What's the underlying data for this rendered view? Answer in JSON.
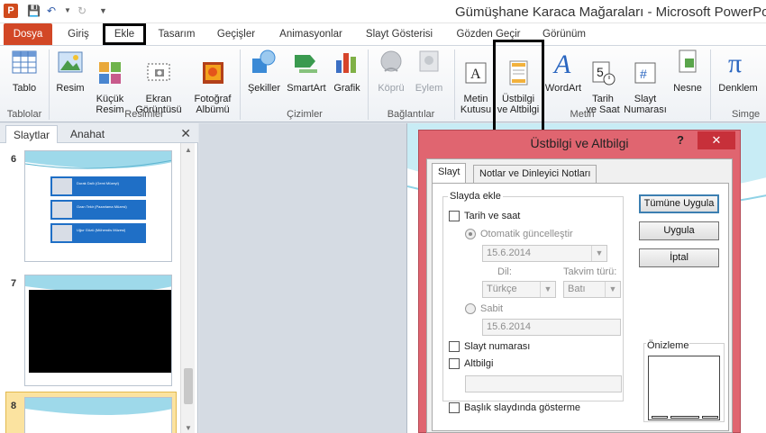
{
  "window": {
    "title": "Gümüşhane Karaca Mağaraları - Microsoft PowerPoint",
    "app_icon_letter": "P"
  },
  "tabs": [
    {
      "label": "Dosya"
    },
    {
      "label": "Giriş"
    },
    {
      "label": "Ekle"
    },
    {
      "label": "Tasarım"
    },
    {
      "label": "Geçişler"
    },
    {
      "label": "Animasyonlar"
    },
    {
      "label": "Slayt Gösterisi"
    },
    {
      "label": "Gözden Geçir"
    },
    {
      "label": "Görünüm"
    }
  ],
  "ribbon": {
    "buttons": {
      "tablo": "Tablo",
      "resim": "Resim",
      "kucuk_resim": "Küçük\nResim",
      "ekran_goruntusu": "Ekran\nGörüntüsü",
      "fotograf_albumu": "Fotoğraf\nAlbümü",
      "sekiller": "Şekiller",
      "smartart": "SmartArt",
      "grafik": "Grafik",
      "kopru": "Köprü",
      "eylem": "Eylem",
      "metin_kutusu": "Metin\nKutusu",
      "ustbilgi": "Üstbilgi\nve Altbilgi",
      "wordart": "WordArt",
      "tarih_saat": "Tarih\nve Saat",
      "slayt_numarasi": "Slayt\nNumarası",
      "nesne": "Nesne",
      "denklem": "Denklem"
    },
    "groups": {
      "tablolar": "Tablolar",
      "resimler": "Resimler",
      "cizimler": "Çizimler",
      "baglantilar": "Bağlantılar",
      "metin": "Metin",
      "simgeler": "Simge"
    }
  },
  "leftpane": {
    "tab_slides": "Slaytlar",
    "tab_outline": "Anahat",
    "slides": [
      {
        "number": "6",
        "items": [
          "Durak Dallı (Gemi Müzeyi)",
          "Ozan Tekir (Pazarlama Müzesi)",
          "Uğur Gözü (Mühendis Müzesi)"
        ]
      },
      {
        "number": "7"
      },
      {
        "number": "8"
      }
    ]
  },
  "dialog": {
    "title": "Üstbilgi ve Altbilgi",
    "help": "?",
    "close": "✕",
    "tabs": [
      "Slayt",
      "Notlar ve Dinleyici Notları"
    ],
    "section_label": "Slayda ekle",
    "date_time_label": "Tarih ve saat",
    "auto_update_label": "Otomatik güncelleştir",
    "auto_date_value": "15.6.2014",
    "language_label": "Dil:",
    "language_value": "Türkçe",
    "calendar_label": "Takvim türü:",
    "calendar_value": "Batı",
    "fixed_label": "Sabit",
    "fixed_value": "15.6.2014",
    "slide_number_label": "Slayt numarası",
    "footer_label": "Altbilgi",
    "footer_value": "",
    "dont_show_title_label": "Başlık slaydında gösterme",
    "apply_all_label": "Tümüne Uygula",
    "apply_label": "Uygula",
    "cancel_label": "İptal",
    "preview_label": "Önizleme"
  },
  "colors": {
    "file_tab": "#d24726",
    "dialog_frame": "#e06570",
    "close_button": "#c7303a",
    "slide_bar": "#1f6fc6"
  }
}
